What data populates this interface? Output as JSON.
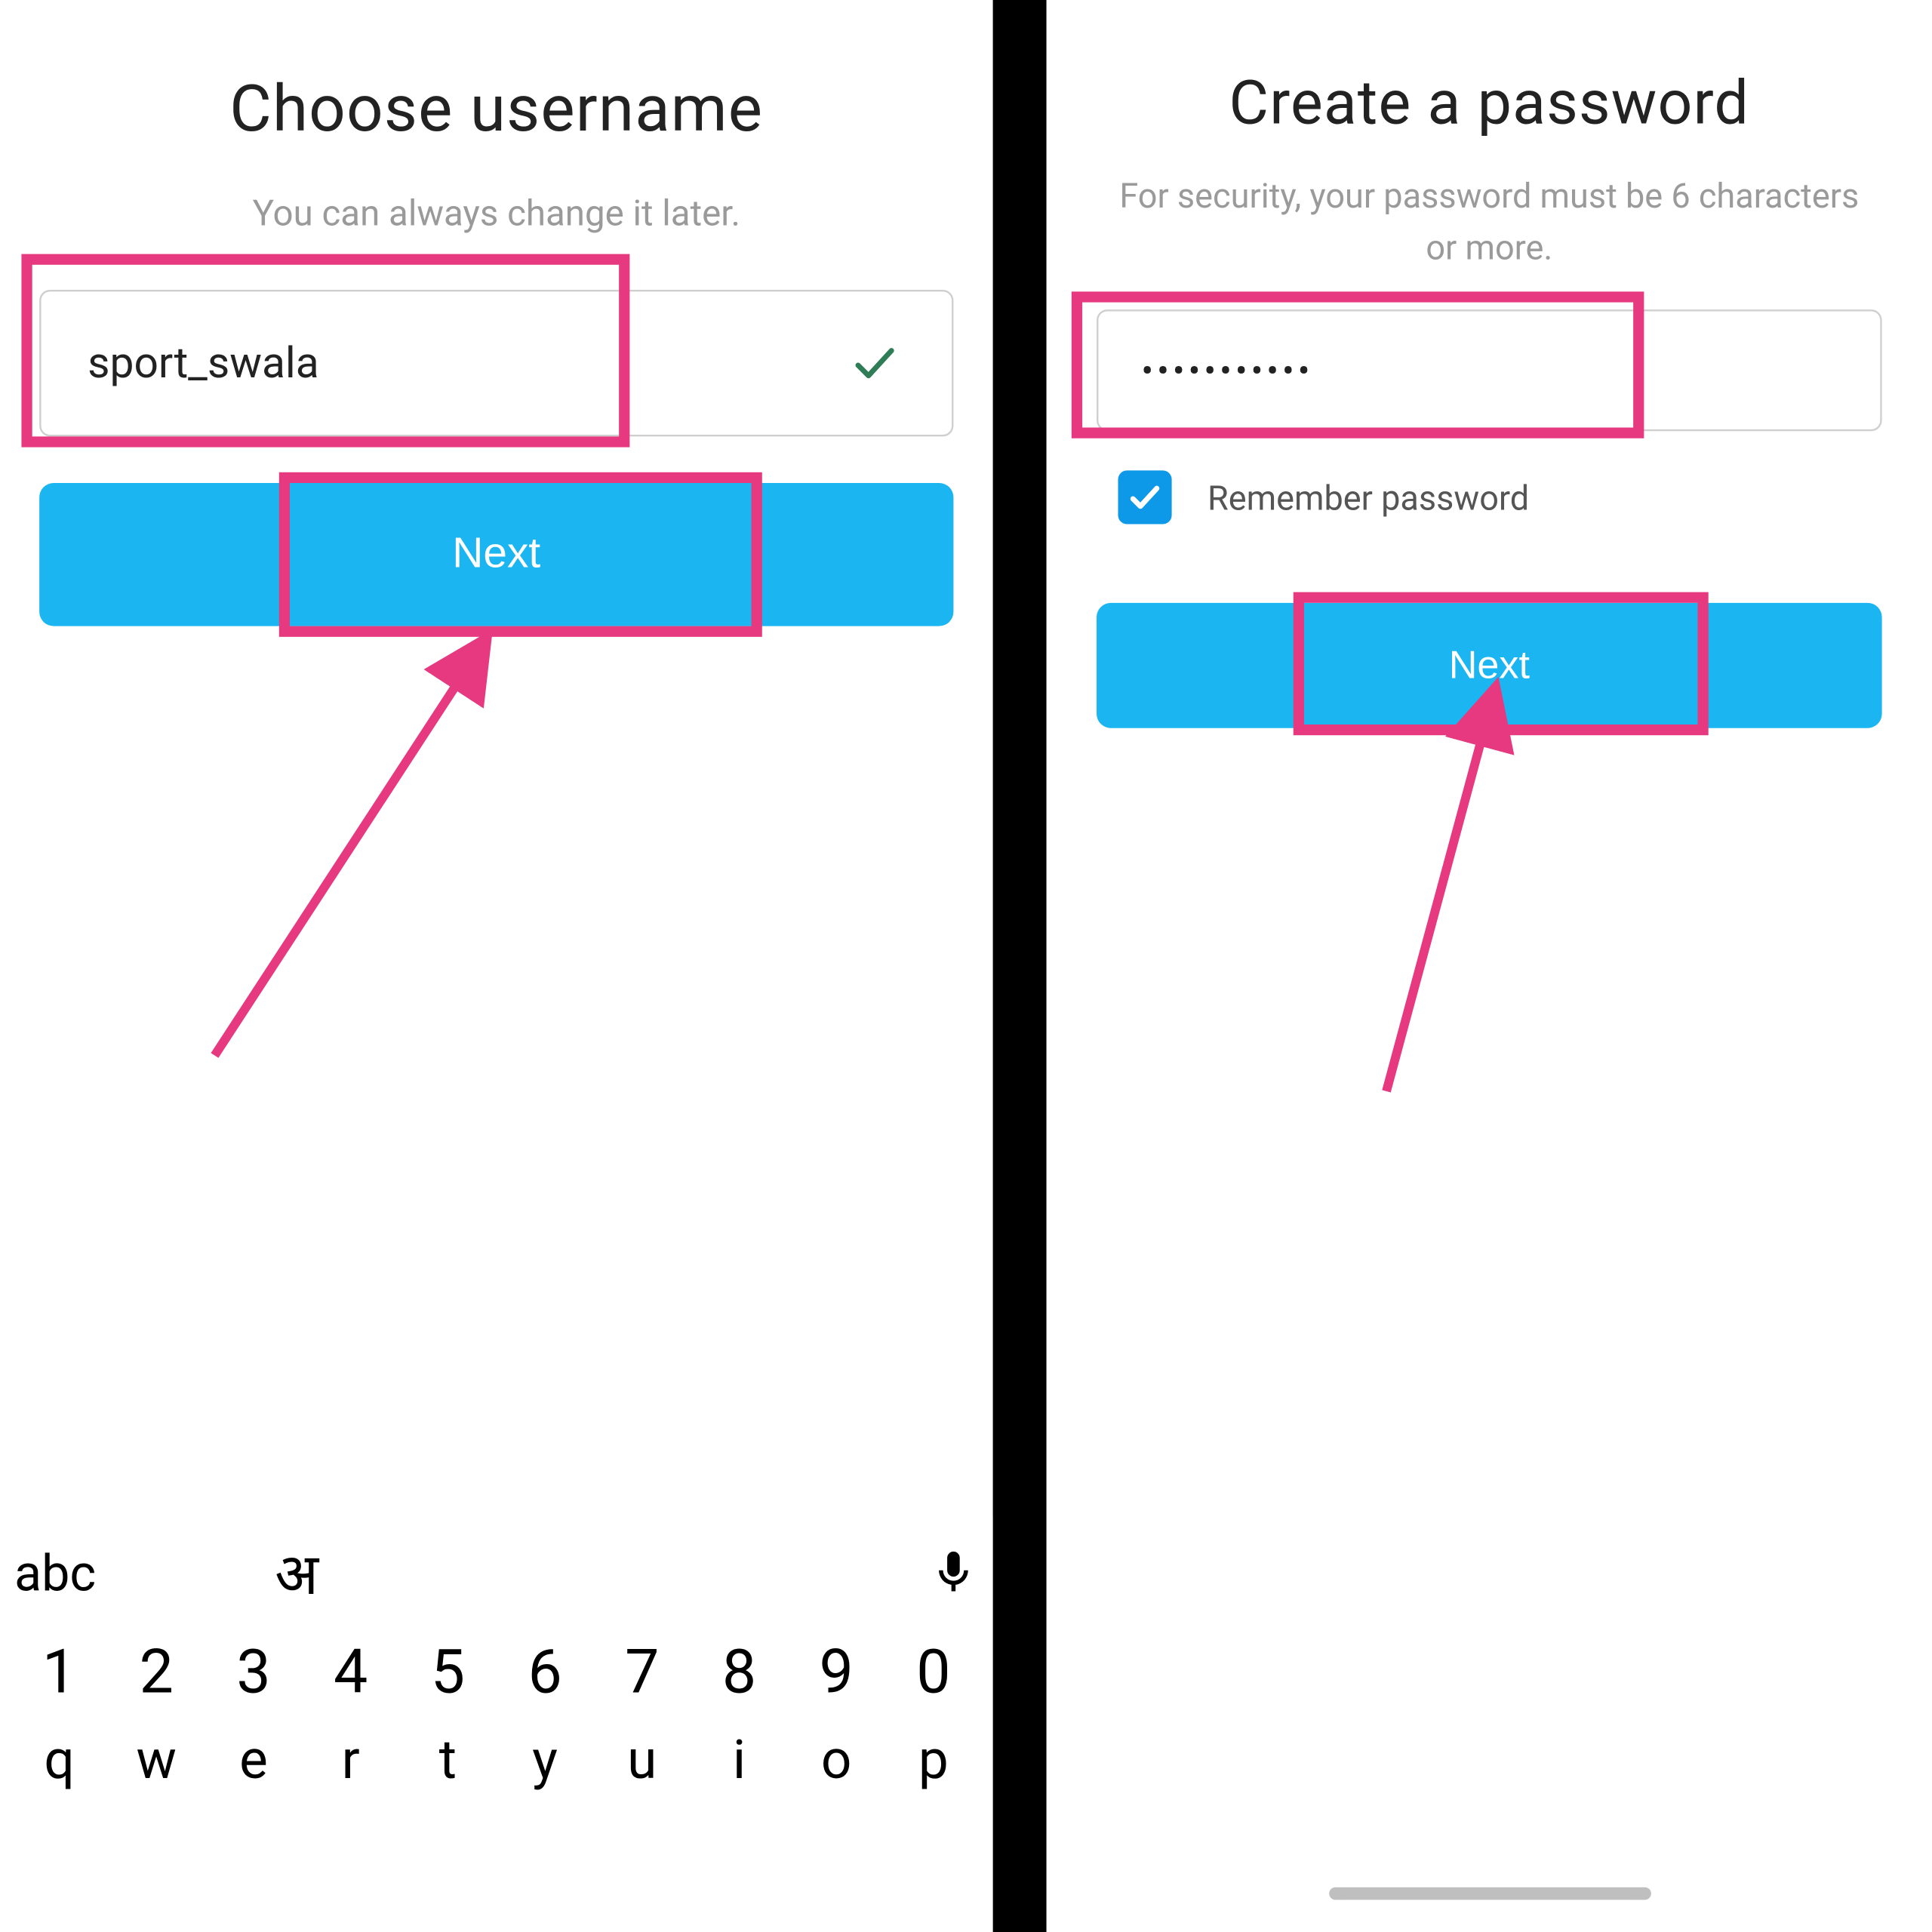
{
  "left": {
    "title": "Choose username",
    "subtitle": "You can always change it later.",
    "username_value": "sport_swala",
    "next_label": "Next"
  },
  "right": {
    "title": "Create a password",
    "subtitle": "For security, your password must be 6 characters or more.",
    "password_display": "•••••••••••",
    "remember_label": "Remember password",
    "next_label": "Next"
  },
  "keyboard": {
    "mode": "abc",
    "lang_glyph": "अ",
    "row_numbers": [
      "1",
      "2",
      "3",
      "4",
      "5",
      "6",
      "7",
      "8",
      "9",
      "0"
    ],
    "row_letters": [
      "q",
      "w",
      "e",
      "r",
      "t",
      "y",
      "u",
      "i",
      "o",
      "p"
    ]
  },
  "colors": {
    "highlight": "#e6397f",
    "primary": "#1bb5f1",
    "checkbox": "#0d99e8"
  }
}
